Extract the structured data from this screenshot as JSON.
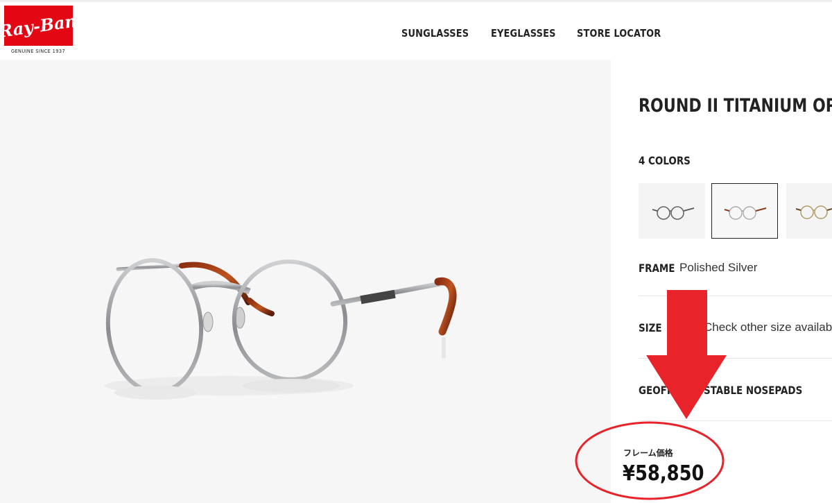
{
  "brand": {
    "logo_text": "Ray-Ban",
    "tagline": "GENUINE SINCE 1937",
    "color": "#e30613"
  },
  "nav": {
    "items": [
      {
        "label": "SUNGLASSES"
      },
      {
        "label": "EYEGLASSES"
      },
      {
        "label": "STORE LOCATOR"
      }
    ]
  },
  "product": {
    "title": "ROUND II TITANIUM OPT",
    "colors_label": "4 COLORS",
    "frame_label": "FRAME",
    "frame_value": "Polished Silver",
    "size_label": "SIZE",
    "size_value": "Check other size availab",
    "geofit_label": "GEOFI",
    "geofit_value": "STABLE NOSEPADS",
    "price_label": "フレーム価格",
    "price": "¥58,850",
    "selected_swatch": 1
  },
  "annotation": {
    "arrow_color": "#e8232a",
    "circle_color": "#e8232a"
  }
}
